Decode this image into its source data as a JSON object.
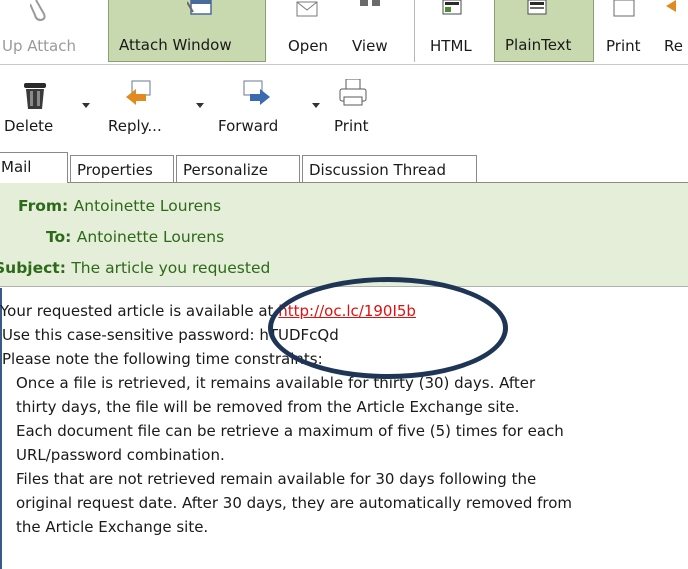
{
  "toolbar_top": {
    "buttons": [
      {
        "id": "up-attach",
        "label": "Up Attach"
      },
      {
        "id": "attach-window",
        "label": "Attach Window"
      },
      {
        "id": "open",
        "label": "Open"
      },
      {
        "id": "view",
        "label": "View"
      },
      {
        "id": "html",
        "label": "HTML"
      },
      {
        "id": "plaintext",
        "label": "PlainText"
      },
      {
        "id": "print",
        "label": "Print"
      },
      {
        "id": "re",
        "label": "Re"
      }
    ]
  },
  "toolbar_main": {
    "buttons": [
      {
        "id": "delete",
        "label": "Delete"
      },
      {
        "id": "reply",
        "label": "Reply..."
      },
      {
        "id": "forward",
        "label": "Forward"
      },
      {
        "id": "print",
        "label": "Print"
      }
    ]
  },
  "tabs": [
    {
      "label": "Mail",
      "active": true
    },
    {
      "label": "Properties",
      "active": false
    },
    {
      "label": "Personalize",
      "active": false
    },
    {
      "label": "Discussion Thread",
      "active": false
    }
  ],
  "header": {
    "from_label": "From:",
    "from_value": "Antoinette Lourens",
    "to_label": "To:",
    "to_value": "Antoinette Lourens",
    "subject_label": "Subject:",
    "subject_value": "The article you requested"
  },
  "message": {
    "line1_prefix": "Your requested article is available at ",
    "line1_link": "http://oc.lc/190I5b",
    "line2": "Use this case-sensitive password: hTUDFcQd",
    "line3": "Please note the following time constraints:",
    "line4": "Once a file is retrieved, it remains available for thirty (30) days. After",
    "line5": "thirty days, the file will be removed from the Article Exchange site.",
    "line6": "Each document file can be retrieve a maximum of five (5) times for each",
    "line7": "URL/password combination.",
    "line8": "Files that are not retrieved remain available for 30 days following the",
    "line9": "original request date. After 30 days, they are automatically removed from",
    "line10": "the Article Exchange site."
  },
  "colors": {
    "header_bg": "#e5eed8",
    "header_text": "#2c6a1a",
    "link": "#e01010",
    "active_button": "#c8d9b0",
    "annotation_oval": "#1e3556"
  }
}
